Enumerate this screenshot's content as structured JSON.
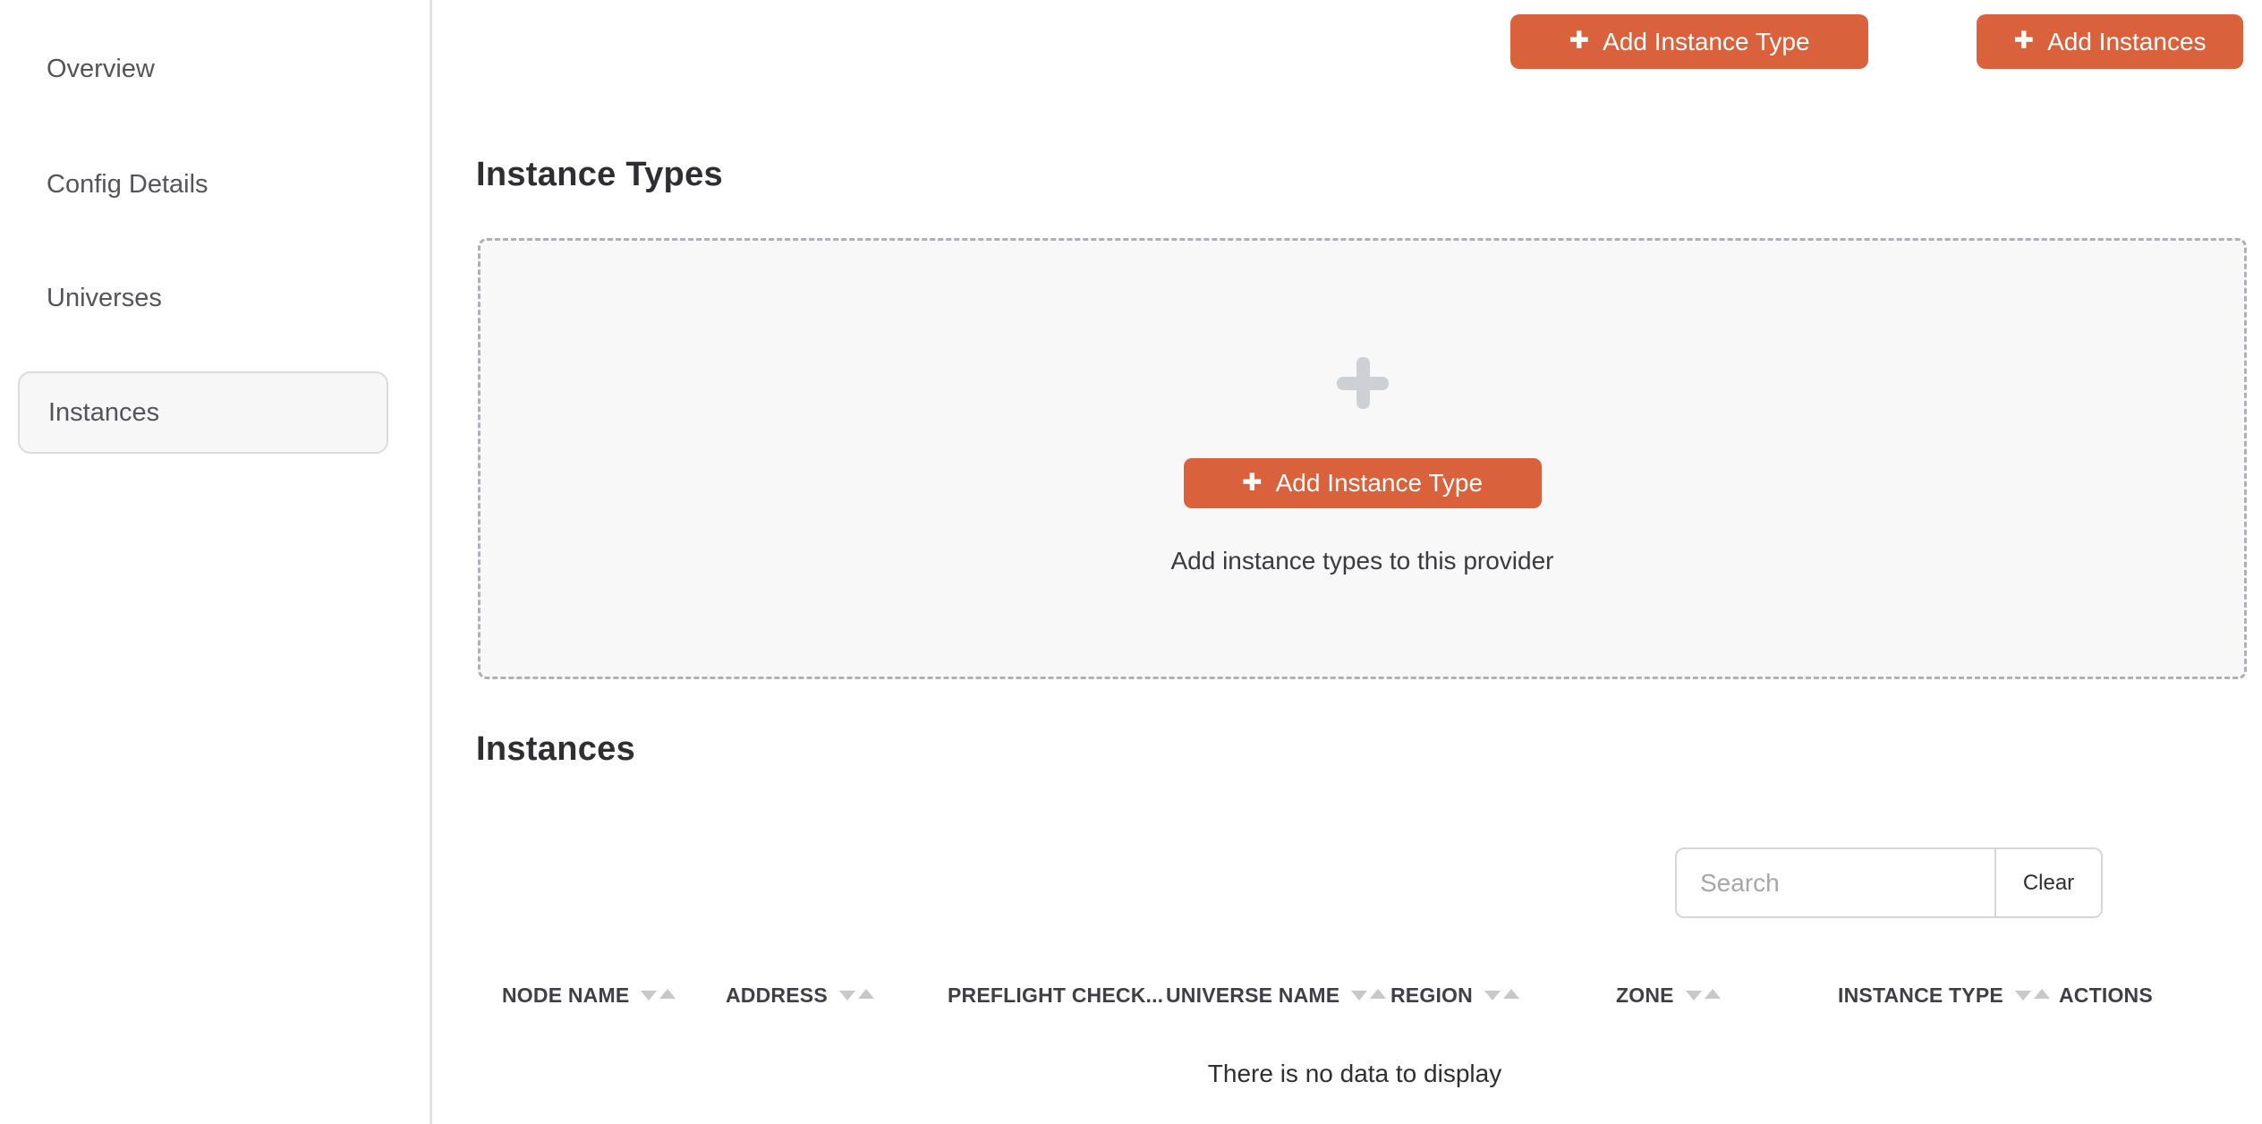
{
  "sidebar": {
    "items": [
      {
        "label": "Overview",
        "selected": false
      },
      {
        "label": "Config Details",
        "selected": false
      },
      {
        "label": "Universes",
        "selected": false
      },
      {
        "label": "Instances",
        "selected": true
      }
    ]
  },
  "header": {
    "plus_glyph": "✚",
    "add_instance_type_label": "Add Instance Type",
    "add_instances_label": "Add Instances"
  },
  "instance_types_section": {
    "title": "Instance Types",
    "empty_panel": {
      "plus_glyph": "✚",
      "button_label": "Add Instance Type",
      "caption": "Add instance types to this provider"
    }
  },
  "instances_section": {
    "title": "Instances",
    "search": {
      "placeholder": "Search",
      "value": "",
      "clear_label": "Clear"
    },
    "table": {
      "columns": [
        {
          "label": "NODE NAME",
          "sortable": true
        },
        {
          "label": "ADDRESS",
          "sortable": true
        },
        {
          "label": "PREFLIGHT CHECK...",
          "sortable": false
        },
        {
          "label": "UNIVERSE NAME",
          "sortable": true
        },
        {
          "label": "REGION",
          "sortable": true
        },
        {
          "label": "ZONE",
          "sortable": true
        },
        {
          "label": "INSTANCE TYPE",
          "sortable": true
        },
        {
          "label": "ACTIONS",
          "sortable": false
        }
      ],
      "empty_message": "There is no data to display"
    }
  },
  "colors": {
    "accent_orange": "#D9613C",
    "panel_background": "#F8F8F9",
    "dashed_border": "#B0B0B6",
    "sort_icon_gray": "#C8C8CC"
  }
}
